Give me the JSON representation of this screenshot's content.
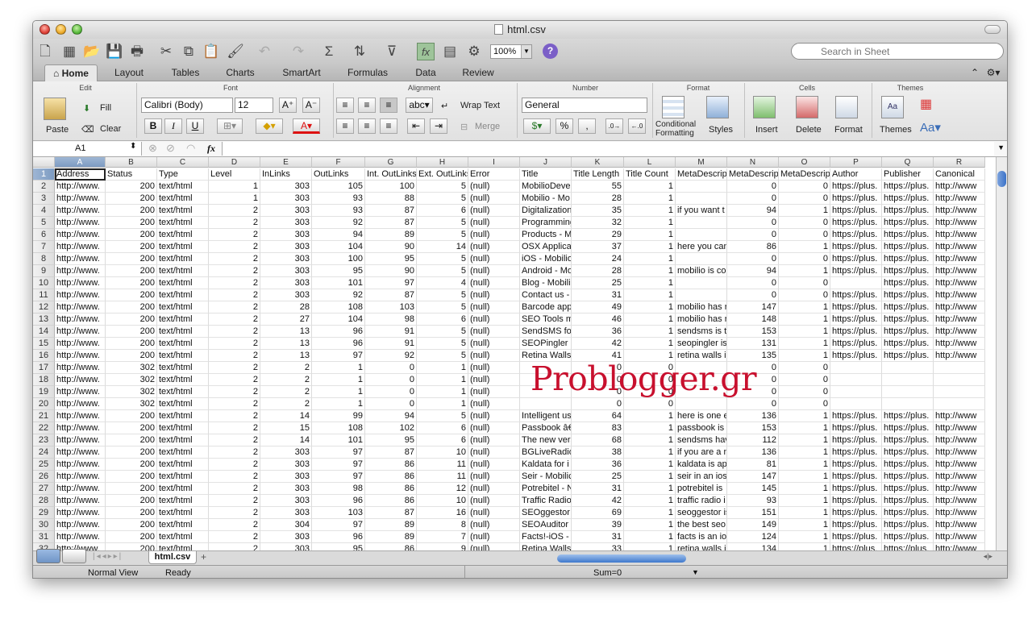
{
  "window": {
    "title": "html.csv"
  },
  "toolbar": {
    "zoom": "100%",
    "search_placeholder": "Search in Sheet"
  },
  "tabs": [
    "Home",
    "Layout",
    "Tables",
    "Charts",
    "SmartArt",
    "Formulas",
    "Data",
    "Review"
  ],
  "ribbon": {
    "groups": {
      "edit": "Edit",
      "font": "Font",
      "alignment": "Alignment",
      "number": "Number",
      "format": "Format",
      "cells": "Cells",
      "themes": "Themes"
    },
    "paste": "Paste",
    "fill": "Fill",
    "clear": "Clear",
    "font_name": "Calibri (Body)",
    "font_size": "12",
    "wrap_text": "Wrap Text",
    "merge": "Merge",
    "number_format": "General",
    "conditional_formatting_1": "Conditional",
    "conditional_formatting_2": "Formatting",
    "styles": "Styles",
    "insert": "Insert",
    "delete": "Delete",
    "format": "Format",
    "themes": "Themes"
  },
  "formula_bar": {
    "name_box": "A1",
    "fx": "fx",
    "formula": ""
  },
  "grid": {
    "columns": [
      "A",
      "B",
      "C",
      "D",
      "E",
      "F",
      "G",
      "H",
      "I",
      "J",
      "K",
      "L",
      "M",
      "N",
      "O",
      "P",
      "Q",
      "R"
    ],
    "header_row": [
      "Address",
      "Status",
      "Type",
      "Level",
      "InLinks",
      "OutLinks",
      "Int. OutLinks",
      "Ext. OutLinks",
      "Error",
      "Title",
      "Title Length",
      "Title Count",
      "MetaDescrip",
      "MetaDescrip",
      "MetaDescrip",
      "Author",
      "Publisher",
      "Canonical"
    ],
    "rows": [
      [
        "http://www.",
        "200",
        "text/html",
        "1",
        "303",
        "105",
        "100",
        "5",
        "(null)",
        "MobilioDeve",
        "55",
        "1",
        "",
        "0",
        "0",
        "https://plus.",
        "https://plus.",
        "http://www"
      ],
      [
        "http://www.",
        "200",
        "text/html",
        "1",
        "303",
        "93",
        "88",
        "5",
        "(null)",
        "Mobilio - Mo",
        "28",
        "1",
        "",
        "0",
        "0",
        "https://plus.",
        "https://plus.",
        "http://www"
      ],
      [
        "http://www.",
        "200",
        "text/html",
        "2",
        "303",
        "93",
        "87",
        "6",
        "(null)",
        "Digitalization",
        "35",
        "1",
        "if you want t",
        "94",
        "1",
        "https://plus.",
        "https://plus.",
        "http://www"
      ],
      [
        "http://www.",
        "200",
        "text/html",
        "2",
        "303",
        "92",
        "87",
        "5",
        "(null)",
        "Programming",
        "32",
        "1",
        "",
        "0",
        "0",
        "https://plus.",
        "https://plus.",
        "http://www"
      ],
      [
        "http://www.",
        "200",
        "text/html",
        "2",
        "303",
        "94",
        "89",
        "5",
        "(null)",
        "Products - M",
        "29",
        "1",
        "",
        "0",
        "0",
        "https://plus.",
        "https://plus.",
        "http://www"
      ],
      [
        "http://www.",
        "200",
        "text/html",
        "2",
        "303",
        "104",
        "90",
        "14",
        "(null)",
        "OSX Applicat",
        "37",
        "1",
        "here you can",
        "86",
        "1",
        "https://plus.",
        "https://plus.",
        "http://www"
      ],
      [
        "http://www.",
        "200",
        "text/html",
        "2",
        "303",
        "100",
        "95",
        "5",
        "(null)",
        "iOS - Mobilio",
        "24",
        "1",
        "",
        "0",
        "0",
        "https://plus.",
        "https://plus.",
        "http://www"
      ],
      [
        "http://www.",
        "200",
        "text/html",
        "2",
        "303",
        "95",
        "90",
        "5",
        "(null)",
        "Android - Mo",
        "28",
        "1",
        "mobilio is co",
        "94",
        "1",
        "https://plus.",
        "https://plus.",
        "http://www"
      ],
      [
        "http://www.",
        "200",
        "text/html",
        "2",
        "303",
        "101",
        "97",
        "4",
        "(null)",
        "Blog - Mobili",
        "25",
        "1",
        "",
        "0",
        "0",
        "",
        "https://plus.",
        "http://www"
      ],
      [
        "http://www.",
        "200",
        "text/html",
        "2",
        "303",
        "92",
        "87",
        "5",
        "(null)",
        "Contact us -",
        "31",
        "1",
        "",
        "0",
        "0",
        "https://plus.",
        "https://plus.",
        "http://www"
      ],
      [
        "http://www.",
        "200",
        "text/html",
        "2",
        "28",
        "108",
        "103",
        "5",
        "(null)",
        "Barcode app",
        "49",
        "1",
        "mobilio has r",
        "147",
        "1",
        "https://plus.",
        "https://plus.",
        "http://www"
      ],
      [
        "http://www.",
        "200",
        "text/html",
        "2",
        "27",
        "104",
        "98",
        "6",
        "(null)",
        "SEO Tools m",
        "46",
        "1",
        "mobilio has r",
        "148",
        "1",
        "https://plus.",
        "https://plus.",
        "http://www"
      ],
      [
        "http://www.",
        "200",
        "text/html",
        "2",
        "13",
        "96",
        "91",
        "5",
        "(null)",
        "SendSMS for",
        "36",
        "1",
        "sendsms is th",
        "153",
        "1",
        "https://plus.",
        "https://plus.",
        "http://www"
      ],
      [
        "http://www.",
        "200",
        "text/html",
        "2",
        "13",
        "96",
        "91",
        "5",
        "(null)",
        "SEOPingler -",
        "42",
        "1",
        "seopingler is",
        "131",
        "1",
        "https://plus.",
        "https://plus.",
        "http://www"
      ],
      [
        "http://www.",
        "200",
        "text/html",
        "2",
        "13",
        "97",
        "92",
        "5",
        "(null)",
        "Retina Walls",
        "41",
        "1",
        "retina walls i",
        "135",
        "1",
        "https://plus.",
        "https://plus.",
        "http://www"
      ],
      [
        "http://www.",
        "302",
        "text/html",
        "2",
        "2",
        "1",
        "0",
        "1",
        "(null)",
        "",
        "0",
        "0",
        "",
        "0",
        "0",
        "",
        "",
        ""
      ],
      [
        "http://www.",
        "302",
        "text/html",
        "2",
        "2",
        "1",
        "0",
        "1",
        "(null)",
        "",
        "0",
        "0",
        "",
        "0",
        "0",
        "",
        "",
        ""
      ],
      [
        "http://www.",
        "302",
        "text/html",
        "2",
        "2",
        "1",
        "0",
        "1",
        "(null)",
        "",
        "0",
        "0",
        "",
        "0",
        "0",
        "",
        "",
        ""
      ],
      [
        "http://www.",
        "302",
        "text/html",
        "2",
        "2",
        "1",
        "0",
        "1",
        "(null)",
        "",
        "0",
        "0",
        "",
        "0",
        "0",
        "",
        "",
        ""
      ],
      [
        "http://www.",
        "200",
        "text/html",
        "2",
        "14",
        "99",
        "94",
        "5",
        "(null)",
        "Intelligent us",
        "64",
        "1",
        "here is one e",
        "136",
        "1",
        "https://plus.",
        "https://plus.",
        "http://www"
      ],
      [
        "http://www.",
        "200",
        "text/html",
        "2",
        "15",
        "108",
        "102",
        "6",
        "(null)",
        "Passbook â€",
        "83",
        "1",
        "passbook is a",
        "153",
        "1",
        "https://plus.",
        "https://plus.",
        "http://www"
      ],
      [
        "http://www.",
        "200",
        "text/html",
        "2",
        "14",
        "101",
        "95",
        "6",
        "(null)",
        "The new vers",
        "68",
        "1",
        "sendsms hav",
        "112",
        "1",
        "https://plus.",
        "https://plus.",
        "http://www"
      ],
      [
        "http://www.",
        "200",
        "text/html",
        "2",
        "303",
        "97",
        "87",
        "10",
        "(null)",
        "BGLiveRadio",
        "38",
        "1",
        "if you are a n",
        "136",
        "1",
        "https://plus.",
        "https://plus.",
        "http://www"
      ],
      [
        "http://www.",
        "200",
        "text/html",
        "2",
        "303",
        "97",
        "86",
        "11",
        "(null)",
        "Kaldata for i",
        "36",
        "1",
        "kaldata is ap",
        "81",
        "1",
        "https://plus.",
        "https://plus.",
        "http://www"
      ],
      [
        "http://www.",
        "200",
        "text/html",
        "2",
        "303",
        "97",
        "86",
        "11",
        "(null)",
        "Seir - Mobilic",
        "25",
        "1",
        "seir in an ios",
        "147",
        "1",
        "https://plus.",
        "https://plus.",
        "http://www"
      ],
      [
        "http://www.",
        "200",
        "text/html",
        "2",
        "303",
        "98",
        "86",
        "12",
        "(null)",
        "Potrebitel - N",
        "31",
        "1",
        "potrebitel is",
        "145",
        "1",
        "https://plus.",
        "https://plus.",
        "http://www"
      ],
      [
        "http://www.",
        "200",
        "text/html",
        "2",
        "303",
        "96",
        "86",
        "10",
        "(null)",
        "Traffic Radio",
        "42",
        "1",
        "traffic radio i",
        "93",
        "1",
        "https://plus.",
        "https://plus.",
        "http://www"
      ],
      [
        "http://www.",
        "200",
        "text/html",
        "2",
        "303",
        "103",
        "87",
        "16",
        "(null)",
        "SEOggestor -",
        "69",
        "1",
        "seoggestor is",
        "151",
        "1",
        "https://plus.",
        "https://plus.",
        "http://www"
      ],
      [
        "http://www.",
        "200",
        "text/html",
        "2",
        "304",
        "97",
        "89",
        "8",
        "(null)",
        "SEOAuditor f",
        "39",
        "1",
        "the best seo",
        "149",
        "1",
        "https://plus.",
        "https://plus.",
        "http://www"
      ],
      [
        "http://www.",
        "200",
        "text/html",
        "2",
        "303",
        "96",
        "89",
        "7",
        "(null)",
        "Facts!-iOS - N",
        "31",
        "1",
        "facts is an ios",
        "124",
        "1",
        "https://plus.",
        "https://plus.",
        "http://www"
      ],
      [
        "http://www.",
        "200",
        "text/html",
        "2",
        "303",
        "95",
        "86",
        "9",
        "(null)",
        "Retina Walls",
        "33",
        "1",
        "retina walls i",
        "134",
        "1",
        "https://plus.",
        "https://plus.",
        "http://www"
      ]
    ]
  },
  "sheet_tab": "html.csv",
  "status": {
    "view": "Normal View",
    "state": "Ready",
    "sum": "Sum=0"
  },
  "watermark": "Problogger.gr"
}
